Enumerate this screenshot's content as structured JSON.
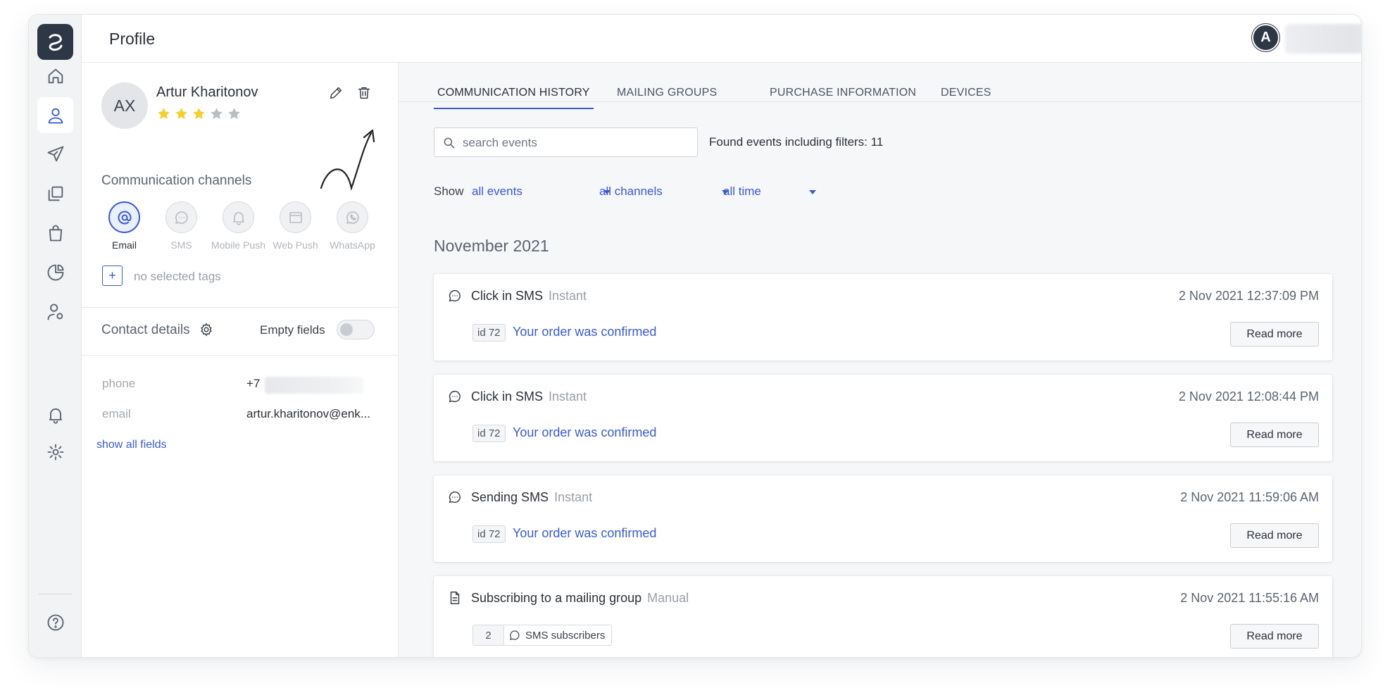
{
  "header": {
    "title": "Profile",
    "user_initial": "A"
  },
  "profile": {
    "initials": "AX",
    "name": "Artur Kharitonov",
    "rating": 3,
    "rating_max": 5,
    "channels_title": "Communication channels",
    "channels": [
      {
        "label": "Email",
        "icon": "at-icon",
        "active": true
      },
      {
        "label": "SMS",
        "icon": "chat-bubble-icon",
        "active": false
      },
      {
        "label": "Mobile Push",
        "icon": "bell-icon",
        "active": false
      },
      {
        "label": "Web Push",
        "icon": "browser-window-icon",
        "active": false
      },
      {
        "label": "WhatsApp",
        "icon": "whatsapp-icon",
        "active": false
      }
    ],
    "tags_placeholder": "no selected tags",
    "tag_add_label": "+",
    "contact_title": "Contact details",
    "empty_fields_label": "Empty fields",
    "empty_fields_on": false,
    "fields": [
      {
        "label": "phone",
        "value": "+7"
      },
      {
        "label": "email",
        "value": "artur.kharitonov@enk..."
      }
    ],
    "show_all_label": "show all fields"
  },
  "tabs": [
    "COMMUNICATION HISTORY",
    "MAILING GROUPS",
    "PURCHASE INFORMATION",
    "DEVICES"
  ],
  "active_tab": 0,
  "search": {
    "placeholder": "search events"
  },
  "found_text": "Found events including filters: 11",
  "filters": {
    "label": "Show",
    "events": "all events",
    "channels": "all channels",
    "time": "all time"
  },
  "month": "November 2021",
  "events": [
    {
      "icon": "chat-bubble-icon",
      "title": "Click in SMS",
      "type": "Instant",
      "date": "2 Nov 2021 12:37:09 PM",
      "id": "id 72",
      "link": "Your order was confirmed",
      "button": "Read more"
    },
    {
      "icon": "chat-bubble-icon",
      "title": "Click in SMS",
      "type": "Instant",
      "date": "2 Nov 2021 12:08:44 PM",
      "id": "id 72",
      "link": "Your order was confirmed",
      "button": "Read more"
    },
    {
      "icon": "chat-bubble-icon",
      "title": "Sending SMS",
      "type": "Instant",
      "date": "2 Nov 2021 11:59:06 AM",
      "id": "id 72",
      "link": "Your order was confirmed",
      "button": "Read more"
    },
    {
      "icon": "document-icon",
      "title": "Subscribing to a mailing group",
      "type": "Manual",
      "date": "2 Nov 2021 11:55:16 AM",
      "group_count": "2",
      "group_name": "SMS subscribers",
      "button": "Read more"
    }
  ],
  "colors": {
    "accent": "#3a5bd3",
    "star_filled": "#f5cf2f",
    "star_empty": "#b9bec5",
    "dark": "#2d3745"
  }
}
